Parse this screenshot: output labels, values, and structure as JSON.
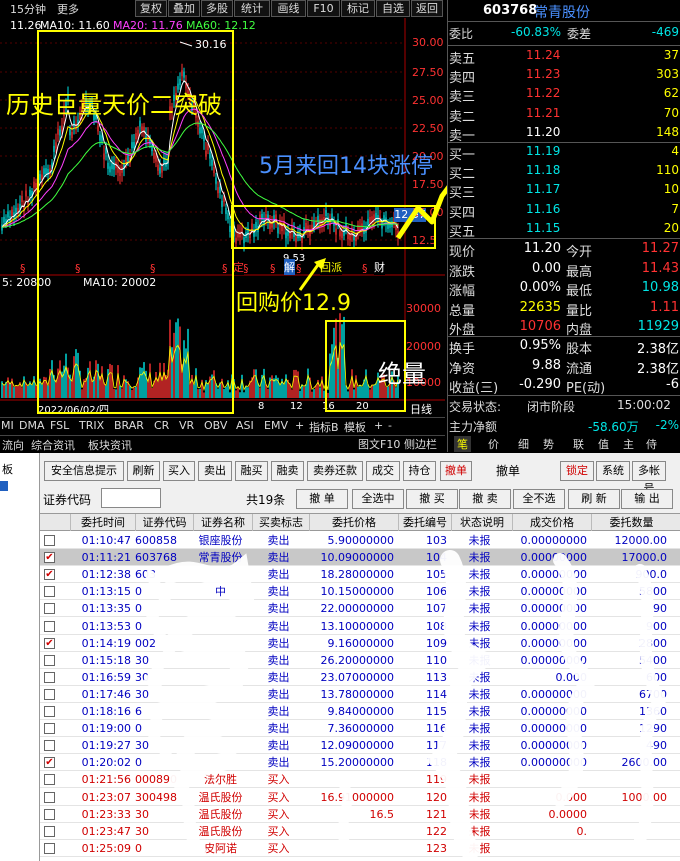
{
  "toolbar": {
    "period": "15分钟",
    "more": "更多",
    "buttons": [
      "复权",
      "叠加",
      "多股",
      "统计",
      "画线",
      "F10",
      "标记",
      "自选",
      "返回"
    ]
  },
  "ma": {
    "last": "11.26",
    "ma10": "MA10: 11.60",
    "ma20": "MA20: 11.76",
    "ma60": "MA60: 12.12"
  },
  "price_axis": [
    "30.00",
    "27.50",
    "25.00",
    "22.50",
    "20.00",
    "17.50",
    "15.00",
    "12.5"
  ],
  "peak_label": "30.16",
  "low_label": "9.53",
  "last_price_tag": "12.67",
  "event_labels": [
    "定",
    "解",
    "回派",
    "财"
  ],
  "vol_ma": {
    "v5": "5: 20800",
    "ma10": "MA10: 20002"
  },
  "vol_axis": [
    "30000",
    "20000",
    "10000"
  ],
  "date_label": "2022/06/02/四",
  "time_axis": [
    "8",
    "12",
    "16",
    "20"
  ],
  "day_line": "日线",
  "indicator_tabs": [
    "MI",
    "DMA",
    "FSL",
    "TRIX",
    "BRAR",
    "CR",
    "VR",
    "OBV",
    "ASI",
    "EMV",
    "+",
    "指标B",
    "模板",
    "+",
    "-"
  ],
  "left_tabs": [
    "流向",
    "综合资讯",
    "板块资讯"
  ],
  "stock": {
    "code": "603768",
    "name": "常青股份"
  },
  "weibi": {
    "label1": "委比",
    "val1": "-60.83%",
    "label2": "委差",
    "val2": "-469"
  },
  "sell": [
    {
      "label": "卖五",
      "price": "11.24",
      "vol": "37"
    },
    {
      "label": "卖四",
      "price": "11.23",
      "vol": "303"
    },
    {
      "label": "卖三",
      "price": "11.22",
      "vol": "62"
    },
    {
      "label": "卖二",
      "price": "11.21",
      "vol": "70"
    },
    {
      "label": "卖一",
      "price": "11.20",
      "vol": "148"
    }
  ],
  "buy": [
    {
      "label": "买一",
      "price": "11.19",
      "vol": "4"
    },
    {
      "label": "买二",
      "price": "11.18",
      "vol": "110"
    },
    {
      "label": "买三",
      "price": "11.17",
      "vol": "10"
    },
    {
      "label": "买四",
      "price": "11.16",
      "vol": "7"
    },
    {
      "label": "买五",
      "price": "11.15",
      "vol": "20"
    }
  ],
  "quote": [
    {
      "l1": "现价",
      "v1": "11.20",
      "l2": "今开",
      "v2": "11.27"
    },
    {
      "l1": "涨跌",
      "v1": "0.00",
      "l2": "最高",
      "v2": "11.43"
    },
    {
      "l1": "涨幅",
      "v1": "0.00%",
      "l2": "最低",
      "v2": "10.98"
    },
    {
      "l1": "总量",
      "v1": "22635",
      "l2": "量比",
      "v2": "1.11"
    },
    {
      "l1": "外盘",
      "v1": "10706",
      "l2": "内盘",
      "v2": "11929"
    }
  ],
  "quote2": [
    {
      "l1": "换手",
      "v1": "0.95%",
      "l2": "股本",
      "v2": "2.38亿"
    },
    {
      "l1": "净资",
      "v1": "9.88",
      "l2": "流通",
      "v2": "2.38亿"
    },
    {
      "l1": "收益(三)",
      "v1": "-0.290",
      "l2": "PE(动)",
      "v2": "-6"
    }
  ],
  "trade_status": {
    "label": "交易状态:",
    "value": "闭市阶段",
    "time": "15:00:02"
  },
  "main_net": {
    "label": "主力净额",
    "value": "-58.60万",
    "pct": "-2%"
  },
  "right_tabs": [
    "图文F10",
    "侧边栏",
    "笔",
    "价",
    "细",
    "势",
    "联",
    "值",
    "主",
    "侍"
  ],
  "buttons_row1": [
    "安全信息提示",
    "刷新",
    "买入",
    "卖出",
    "融买",
    "融卖",
    "卖券还款",
    "成交",
    "持仓",
    "撤单"
  ],
  "cancel_label": "撤单",
  "buttons_row1_right": [
    "锁定",
    "系统",
    "多帐号"
  ],
  "code_label": "证券代码",
  "total": "共19条",
  "buttons_row2": [
    "撤 单",
    "全选中",
    "撤 买",
    "撤 卖",
    "全不选",
    "刷 新",
    "输 出"
  ],
  "table_headers": [
    "委托时间",
    "证券代码",
    "证券名称",
    "买卖标志",
    "委托价格",
    "委托编号",
    "状态说明",
    "成交价格",
    "委托数量"
  ],
  "rows": [
    {
      "time": "01:10:47",
      "code": "600858",
      "name": "银座股份",
      "side": "卖出",
      "price": "5.90000000",
      "no": "103",
      "status": "未报",
      "dprice": "0.00000000",
      "qty": "12000.00",
      "checked": false
    },
    {
      "time": "01:11:21",
      "code": "603768",
      "name": "常青股份",
      "side": "卖出",
      "price": "10.09000000",
      "no": "104",
      "status": "未报",
      "dprice": "0.00000000",
      "qty": "17000.0",
      "checked": true
    },
    {
      "time": "01:12:38",
      "code": "603",
      "name": "",
      "side": "卖出",
      "price": "18.28000000",
      "no": "105",
      "status": "未报",
      "dprice": "0.00000000",
      "qty": "900.0",
      "checked": true
    },
    {
      "time": "01:13:15",
      "code": "0",
      "name": "中",
      "side": "卖出",
      "price": "10.15000000",
      "no": "106",
      "status": "未报",
      "dprice": "0.00000000",
      "qty": "5800",
      "checked": false
    },
    {
      "time": "01:13:35",
      "code": "0",
      "name": "",
      "side": "卖出",
      "price": "22.00000000",
      "no": "107",
      "status": "未报",
      "dprice": "0.00000000",
      "qty": "90",
      "checked": false
    },
    {
      "time": "01:13:53",
      "code": "0",
      "name": "",
      "side": "卖出",
      "price": "13.10000000",
      "no": "108",
      "status": "未报",
      "dprice": "0.00000000",
      "qty": "900",
      "checked": false
    },
    {
      "time": "01:14:19",
      "code": "002",
      "name": "",
      "side": "卖出",
      "price": "9.16000000",
      "no": "109",
      "status": "未报",
      "dprice": "0.00000000",
      "qty": "2800",
      "checked": true
    },
    {
      "time": "01:15:18",
      "code": "30",
      "name": "",
      "side": "卖出",
      "price": "26.20000000",
      "no": "110",
      "status": "未报",
      "dprice": "0.00000000",
      "qty": "5400",
      "checked": false
    },
    {
      "time": "01:16:59",
      "code": "30",
      "name": "",
      "side": "卖出",
      "price": "23.07000000",
      "no": "113",
      "status": "未报",
      "dprice": "0.000",
      "qty": "600",
      "checked": false
    },
    {
      "time": "01:17:46",
      "code": "30",
      "name": "",
      "side": "卖出",
      "price": "13.78000000",
      "no": "114",
      "status": "未报",
      "dprice": "0.00000000",
      "qty": "6700",
      "checked": false
    },
    {
      "time": "01:18:16",
      "code": "6",
      "name": "",
      "side": "卖出",
      "price": "9.84000000",
      "no": "115",
      "status": "未报",
      "dprice": "0.00000000",
      "qty": "1360",
      "checked": false
    },
    {
      "time": "01:19:00",
      "code": "0",
      "name": "",
      "side": "卖出",
      "price": "7.36000000",
      "no": "116",
      "status": "未报",
      "dprice": "0.00000000",
      "qty": "1290",
      "checked": false
    },
    {
      "time": "01:19:27",
      "code": "30",
      "name": "",
      "side": "卖出",
      "price": "12.09000000",
      "no": "117",
      "status": "未报",
      "dprice": "0.00000000",
      "qty": "490",
      "checked": false
    },
    {
      "time": "01:20:02",
      "code": "0",
      "name": "",
      "side": "卖出",
      "price": "15.20000000",
      "no": "118",
      "status": "未报",
      "dprice": "0.00000000",
      "qty": "2600.00",
      "checked": true
    },
    {
      "time": "01:21:56",
      "code": "000890",
      "name": "法尔胜",
      "side": "买入",
      "price": "",
      "no": "119",
      "status": "未报",
      "dprice": "",
      "qty": "",
      "checked": false
    },
    {
      "time": "01:23:07",
      "code": "300498",
      "name": "温氏股份",
      "side": "买入",
      "price": "16.91000000",
      "no": "120",
      "status": "未报",
      "dprice": "0.000",
      "qty": "1000.00",
      "checked": false
    },
    {
      "time": "01:23:33",
      "code": "30",
      "name": "温氏股份",
      "side": "买入",
      "price": "16.5",
      "no": "121",
      "status": "未报",
      "dprice": "0.0000",
      "qty": "",
      "checked": false
    },
    {
      "time": "01:23:47",
      "code": "30",
      "name": "温氏股份",
      "side": "买入",
      "price": "",
      "no": "122",
      "status": "未报",
      "dprice": "0.",
      "qty": "",
      "checked": false
    },
    {
      "time": "01:25:09",
      "code": "0",
      "name": "皮阿诺",
      "side": "买入",
      "price": "",
      "no": "123",
      "status": "未报",
      "dprice": "",
      "qty": "",
      "checked": false
    }
  ],
  "annotations": {
    "a1": "历史巨量天价二突破",
    "a2": "5月来回14块涨停",
    "a3": "回购价12.9",
    "a4": "绝量"
  },
  "colors": {
    "up": "#ff3232",
    "down": "#00e5e5",
    "yellow": "#ffff00",
    "blue": "#4a90ff"
  }
}
